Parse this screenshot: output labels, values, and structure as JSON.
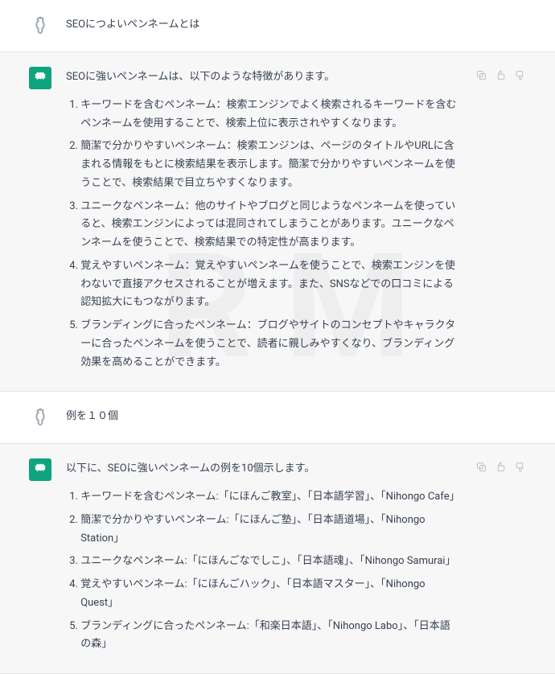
{
  "turns": [
    {
      "role": "user",
      "text": "SEOにつよいペンネームとは"
    },
    {
      "role": "assistant",
      "intro": "SEOに強いペンネームは、以下のような特徴があります。",
      "items": [
        "キーワードを含むペンネーム：検索エンジンでよく検索されるキーワードを含むペンネームを使用することで、検索上位に表示されやすくなります。",
        "簡潔で分かりやすいペンネーム：検索エンジンは、ページのタイトルやURLに含まれる情報をもとに検索結果を表示します。簡潔で分かりやすいペンネームを使うことで、検索結果で目立ちやすくなります。",
        "ユニークなペンネーム：他のサイトやブログと同じようなペンネームを使っていると、検索エンジンによっては混同されてしまうことがあります。ユニークなペンネームを使うことで、検索結果での特定性が高まります。",
        "覚えやすいペンネーム：覚えやすいペンネームを使うことで、検索エンジンを使わないで直接アクセスされることが増えます。また、SNSなどでの口コミによる認知拡大にもつながります。",
        "ブランディングに合ったペンネーム：ブログやサイトのコンセプトやキャラクターに合ったペンネームを使うことで、読者に親しみやすくなり、ブランディング効果を高めることができます。"
      ]
    },
    {
      "role": "user",
      "text": "例を１０個"
    },
    {
      "role": "assistant",
      "intro": "以下に、SEOに強いペンネームの例を10個示します。",
      "items": [
        "キーワードを含むペンネーム:「にほんご教室」、「日本語学習」、「Nihongo Cafe」",
        "簡潔で分かりやすいペンネーム:「にほんご塾」、「日本語道場」、「Nihongo Station」",
        "ユニークなペンネーム:「にほんごなでしこ」、「日本語魂」、「Nihongo Samurai」",
        "覚えやすいペンネーム:「にほんごハック」、「日本語マスター」、「Nihongo Quest」",
        "ブランディングに合ったペンネーム:「和楽日本語」、「Nihongo Labo」、「日本語の森」"
      ]
    }
  ]
}
